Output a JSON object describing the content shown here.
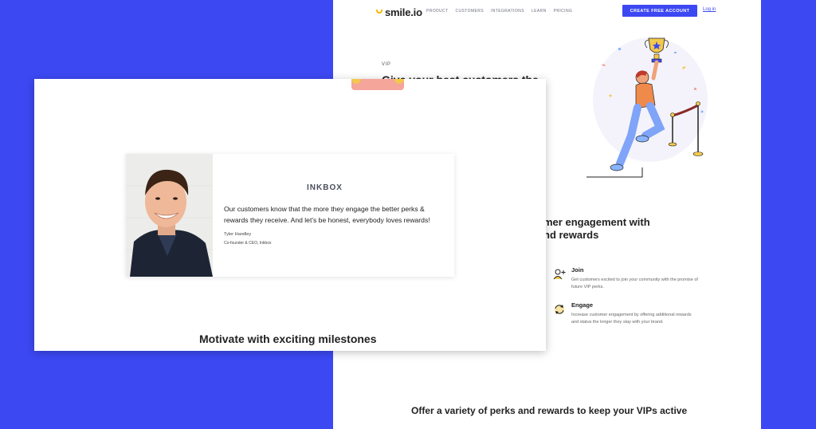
{
  "site": {
    "logo": "smile.io",
    "nav": [
      "PRODUCT",
      "CUSTOMERS",
      "INTEGRATIONS",
      "LEARN",
      "PRICING"
    ],
    "cta": "CREATE FREE ACCOUNT",
    "login": "Log in"
  },
  "hero": {
    "label": "VIP",
    "heading": "Give your best customers the"
  },
  "engagement": {
    "heading_line1": "mer engagement with",
    "heading_line2": "nd rewards"
  },
  "features": [
    {
      "title": "Join",
      "icon": "user-plus-icon",
      "desc": "Get customers excited to join your community with the promise of future VIP perks."
    },
    {
      "title": "Engage",
      "icon": "refresh-icon",
      "desc": "Increase customer engagement by offering additional rewards and status the longer they stay with your brand."
    }
  ],
  "bottom_heading": "Offer a variety of perks and rewards to keep your VIPs active",
  "testimonial": {
    "brand": "INKBOX",
    "quote": "Our customers know that the more they engage the better perks & rewards they receive. And let's be honest, everybody loves rewards!",
    "name": "Tyler Handley",
    "title": "Co-founder & CEO, Inkbox"
  },
  "milestones_heading": "Motivate with exciting milestones",
  "colors": {
    "background": "#3c48f2",
    "accent": "#3c48f2",
    "tape": "#f5a59a",
    "gold": "#f2c94c"
  }
}
